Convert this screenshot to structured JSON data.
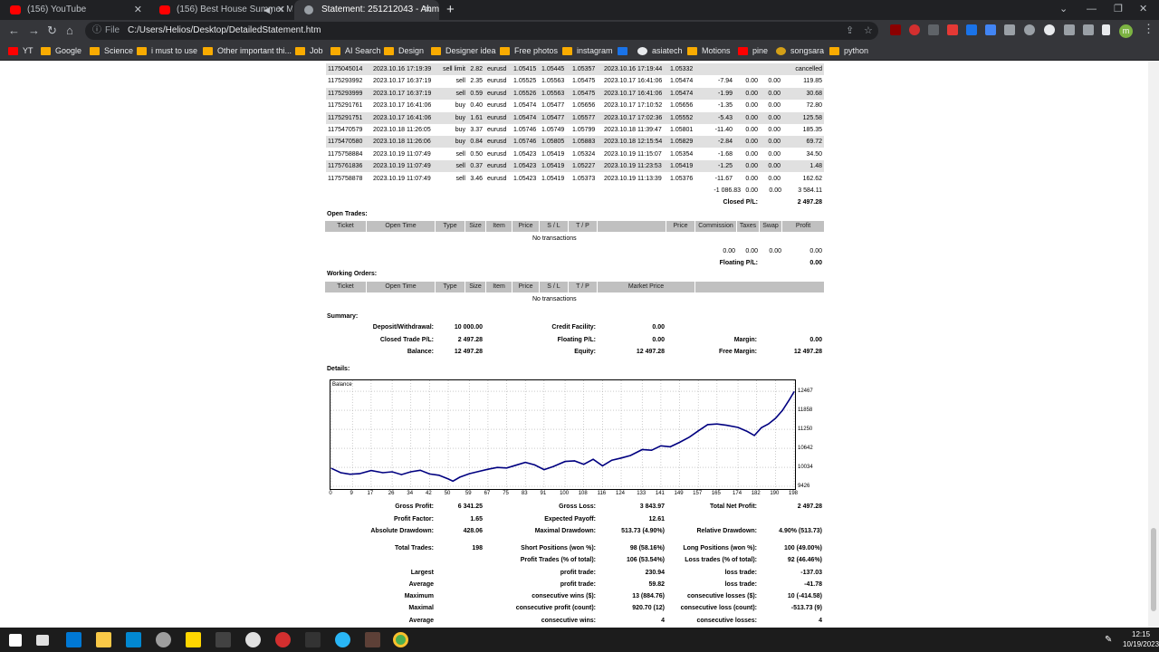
{
  "browser": {
    "tabs": [
      {
        "title": "(156) YouTube"
      },
      {
        "title": "(156) Best House Summer M"
      },
      {
        "title": "Statement: 251212043 - Ahmad"
      }
    ],
    "address_prefix": "File",
    "address": "C:/Users/Helios/Desktop/DetailedStatement.htm",
    "bookmarks": [
      {
        "label": "YT",
        "color": "#ff0000"
      },
      {
        "label": "Google",
        "color": "#f9ab00"
      },
      {
        "label": "Science",
        "color": "#f9ab00"
      },
      {
        "label": "i must to use",
        "color": "#f9ab00"
      },
      {
        "label": "Other important thi...",
        "color": "#f9ab00"
      },
      {
        "label": "Job",
        "color": "#f9ab00"
      },
      {
        "label": "AI Search",
        "color": "#f9ab00"
      },
      {
        "label": "Design",
        "color": "#f9ab00"
      },
      {
        "label": "Designer idea",
        "color": "#f9ab00"
      },
      {
        "label": "Free photos",
        "color": "#f9ab00"
      },
      {
        "label": "instagram",
        "color": "#f9ab00"
      },
      {
        "label": "asiatech",
        "color": "#e8eaed"
      },
      {
        "label": "Motions",
        "color": "#f9ab00"
      },
      {
        "label": "pine",
        "color": "#ff0000"
      },
      {
        "label": "songsara",
        "color": "#d4a017"
      },
      {
        "label": "python",
        "color": "#f9ab00"
      }
    ],
    "profile_initial": "m"
  },
  "trades": [
    [
      "1175045014",
      "2023.10.16 17:19:39",
      "sell limit",
      "2.82",
      "eurusd",
      "1.05415",
      "1.05445",
      "1.05357",
      "2023.10.16 17:19:44",
      "1.05332",
      "",
      "",
      "",
      "cancelled"
    ],
    [
      "1175293992",
      "2023.10.17 16:37:19",
      "sell",
      "2.35",
      "eurusd",
      "1.05525",
      "1.05563",
      "1.05475",
      "2023.10.17 16:41:06",
      "1.05474",
      "-7.94",
      "0.00",
      "0.00",
      "119.85"
    ],
    [
      "1175293999",
      "2023.10.17 16:37:19",
      "sell",
      "0.59",
      "eurusd",
      "1.05526",
      "1.05563",
      "1.05475",
      "2023.10.17 16:41:06",
      "1.05474",
      "-1.99",
      "0.00",
      "0.00",
      "30.68"
    ],
    [
      "1175291761",
      "2023.10.17 16:41:06",
      "buy",
      "0.40",
      "eurusd",
      "1.05474",
      "1.05477",
      "1.05656",
      "2023.10.17 17:10:52",
      "1.05656",
      "-1.35",
      "0.00",
      "0.00",
      "72.80"
    ],
    [
      "1175291751",
      "2023.10.17 16:41:06",
      "buy",
      "1.61",
      "eurusd",
      "1.05474",
      "1.05477",
      "1.05577",
      "2023.10.17 17:02:36",
      "1.05552",
      "-5.43",
      "0.00",
      "0.00",
      "125.58"
    ],
    [
      "1175470579",
      "2023.10.18 11:26:05",
      "buy",
      "3.37",
      "eurusd",
      "1.05746",
      "1.05749",
      "1.05799",
      "2023.10.18 11:39:47",
      "1.05801",
      "-11.40",
      "0.00",
      "0.00",
      "185.35"
    ],
    [
      "1175470580",
      "2023.10.18 11:26:06",
      "buy",
      "0.84",
      "eurusd",
      "1.05746",
      "1.05805",
      "1.05883",
      "2023.10.18 12:15:54",
      "1.05829",
      "-2.84",
      "0.00",
      "0.00",
      "69.72"
    ],
    [
      "1175758884",
      "2023.10.19 11:07:49",
      "sell",
      "0.50",
      "eurusd",
      "1.05423",
      "1.05419",
      "1.05324",
      "2023.10.19 11:15:07",
      "1.05354",
      "-1.68",
      "0.00",
      "0.00",
      "34.50"
    ],
    [
      "1175761836",
      "2023.10.19 11:07:49",
      "sell",
      "0.37",
      "eurusd",
      "1.05423",
      "1.05419",
      "1.05227",
      "2023.10.19 11:23:53",
      "1.05419",
      "-1.25",
      "0.00",
      "0.00",
      "1.48"
    ],
    [
      "1175758878",
      "2023.10.19 11:07:49",
      "sell",
      "3.46",
      "eurusd",
      "1.05423",
      "1.05419",
      "1.05373",
      "2023.10.19 11:13:39",
      "1.05376",
      "-11.67",
      "0.00",
      "0.00",
      "162.62"
    ]
  ],
  "closed_totals": {
    "commission": "-1 086.83",
    "taxes": "0.00",
    "swap": "0.00",
    "profit": "3 584.11",
    "pl_label": "Closed P/L:",
    "pl_value": "2 497.28"
  },
  "open_trades": {
    "title": "Open Trades:",
    "headers": [
      "Ticket",
      "Open Time",
      "Type",
      "Size",
      "Item",
      "Price",
      "S / L",
      "T / P",
      "",
      "Price",
      "Commission",
      "Taxes",
      "Swap",
      "Profit"
    ],
    "empty": "No transactions",
    "commission": "0.00",
    "taxes": "0.00",
    "swap": "0.00",
    "profit": "0.00",
    "pl_label": "Floating P/L:",
    "pl_value": "0.00"
  },
  "working_orders": {
    "title": "Working Orders:",
    "headers": [
      "Ticket",
      "Open Time",
      "Type",
      "Size",
      "Item",
      "Price",
      "S / L",
      "T / P",
      "Market Price"
    ],
    "empty": "No transactions"
  },
  "summary": {
    "title": "Summary:",
    "deposit_label": "Deposit/Withdrawal:",
    "deposit": "10 000.00",
    "credit_label": "Credit Facility:",
    "credit": "0.00",
    "closed_label": "Closed Trade P/L:",
    "closed": "2 497.28",
    "floating_label": "Floating P/L:",
    "floating": "0.00",
    "margin_label": "Margin:",
    "margin": "0.00",
    "balance_label": "Balance:",
    "balance": "12 497.28",
    "equity_label": "Equity:",
    "equity": "12 497.28",
    "free_margin_label": "Free Margin:",
    "free_margin": "12 497.28"
  },
  "details": {
    "title": "Details:"
  },
  "chart_data": {
    "type": "line",
    "title": "Balance",
    "xlabel": "",
    "ylabel": "",
    "x_ticks": [
      "0",
      "9",
      "17",
      "26",
      "34",
      "42",
      "50",
      "59",
      "67",
      "75",
      "83",
      "91",
      "100",
      "108",
      "116",
      "124",
      "133",
      "141",
      "149",
      "157",
      "165",
      "174",
      "182",
      "190",
      "198"
    ],
    "y_ticks": [
      "12467",
      "11858",
      "11250",
      "10642",
      "10034",
      "9426"
    ],
    "xlim": [
      0,
      198
    ],
    "ylim": [
      9426,
      12700
    ],
    "line_color": "#000080",
    "grid": true,
    "x": [
      0,
      4,
      8,
      12,
      17,
      22,
      26,
      30,
      34,
      38,
      42,
      46,
      50,
      52,
      55,
      59,
      63,
      67,
      71,
      75,
      79,
      83,
      87,
      91,
      95,
      100,
      104,
      108,
      112,
      116,
      120,
      124,
      128,
      133,
      137,
      141,
      145,
      149,
      153,
      157,
      161,
      165,
      169,
      174,
      178,
      181,
      184,
      187,
      190,
      193,
      196,
      198
    ],
    "y": [
      10000,
      9860,
      9810,
      9830,
      9930,
      9860,
      9890,
      9800,
      9890,
      9940,
      9820,
      9780,
      9660,
      9590,
      9720,
      9830,
      9900,
      9970,
      10030,
      10010,
      10100,
      10190,
      10110,
      9960,
      10060,
      10220,
      10240,
      10130,
      10290,
      10080,
      10260,
      10330,
      10410,
      10600,
      10580,
      10720,
      10690,
      10830,
      10990,
      11200,
      11400,
      11420,
      11380,
      11310,
      11180,
      11050,
      11300,
      11420,
      11600,
      11850,
      12200,
      12450
    ]
  },
  "stats": {
    "gross_profit_label": "Gross Profit:",
    "gross_profit": "6 341.25",
    "gross_loss_label": "Gross Loss:",
    "gross_loss": "3 843.97",
    "total_net_label": "Total Net Profit:",
    "total_net": "2 497.28",
    "profit_factor_label": "Profit Factor:",
    "profit_factor": "1.65",
    "expected_payoff_label": "Expected Payoff:",
    "expected_payoff": "12.61",
    "abs_dd_label": "Absolute Drawdown:",
    "abs_dd": "428.06",
    "max_dd_label": "Maximal Drawdown:",
    "max_dd": "513.73 (4.90%)",
    "rel_dd_label": "Relative Drawdown:",
    "rel_dd": "4.90% (513.73)",
    "total_trades_label": "Total Trades:",
    "total_trades": "198",
    "short_label": "Short Positions (won %):",
    "short": "98 (58.16%)",
    "long_label": "Long Positions (won %):",
    "long": "100 (49.00%)",
    "profit_trades_label": "Profit Trades (% of total):",
    "profit_trades": "106 (53.54%)",
    "loss_trades_label": "Loss trades (% of total):",
    "loss_trades": "92 (46.46%)",
    "largest_label": "Largest",
    "largest_profit_label": "profit trade:",
    "largest_profit": "230.94",
    "largest_loss_label": "loss trade:",
    "largest_loss": "-137.03",
    "average_label": "Average",
    "average_profit_label": "profit trade:",
    "average_profit": "59.82",
    "average_loss_label": "loss trade:",
    "average_loss": "-41.78",
    "maximum_label": "Maximum",
    "max_wins_label": "consecutive wins ($):",
    "max_wins": "13 (884.76)",
    "max_losses_label": "consecutive losses ($):",
    "max_losses": "10 (-414.58)",
    "maximal_label": "Maximal",
    "maximal_profit_label": "consecutive profit (count):",
    "maximal_profit": "920.70 (12)",
    "maximal_loss_label": "consecutive loss (count):",
    "maximal_loss": "-513.73 (9)",
    "average2_label": "Average",
    "avg_cons_wins_label": "consecutive wins:",
    "avg_cons_wins": "4",
    "avg_cons_losses_label": "consecutive losses:",
    "avg_cons_losses": "4"
  },
  "taskbar": {
    "time": "12:15",
    "date": "10/19/2023"
  }
}
